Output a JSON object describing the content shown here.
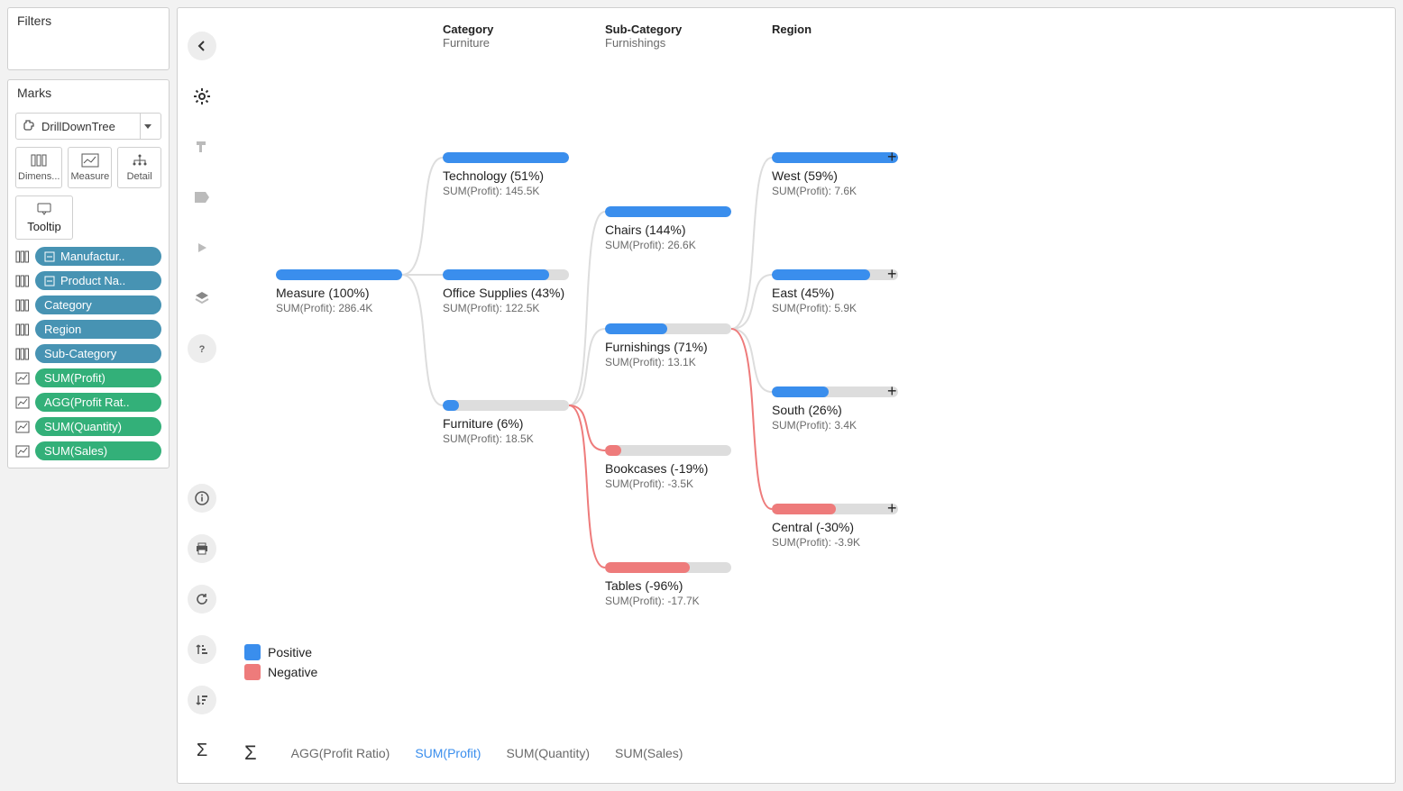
{
  "sidebar": {
    "filters_title": "Filters",
    "marks_title": "Marks",
    "mark_type": "DrillDownTree",
    "shelves": {
      "dimens": "Dimens...",
      "measure": "Measure",
      "detail": "Detail",
      "tooltip": "Tooltip"
    },
    "fields": [
      {
        "icon": "col",
        "pill": "blue",
        "prefix": "box",
        "label": "Manufactur.."
      },
      {
        "icon": "col",
        "pill": "blue",
        "prefix": "box",
        "label": "Product Na.."
      },
      {
        "icon": "col",
        "pill": "blue",
        "label": "Category"
      },
      {
        "icon": "col",
        "pill": "blue",
        "label": "Region"
      },
      {
        "icon": "col",
        "pill": "blue",
        "label": "Sub-Category"
      },
      {
        "icon": "line",
        "pill": "green",
        "label": "SUM(Profit)"
      },
      {
        "icon": "line",
        "pill": "green",
        "label": "AGG(Profit Rat.."
      },
      {
        "icon": "line",
        "pill": "green",
        "label": "SUM(Quantity)"
      },
      {
        "icon": "line",
        "pill": "green",
        "label": "SUM(Sales)"
      }
    ]
  },
  "headers": {
    "col1": {
      "title": "Category",
      "sub": "Furniture"
    },
    "col2": {
      "title": "Sub-Category",
      "sub": "Furnishings"
    },
    "col3": {
      "title": "Region",
      "sub": ""
    }
  },
  "legend": {
    "pos": "Positive",
    "neg": "Negative"
  },
  "footer": {
    "items": [
      "AGG(Profit Ratio)",
      "SUM(Profit)",
      "SUM(Quantity)",
      "SUM(Sales)"
    ],
    "active_index": 1
  },
  "nodes": {
    "root": {
      "label": "Measure (100%)",
      "sub": "SUM(Profit): 286.4K",
      "fill": 100,
      "type": "pos"
    },
    "tech": {
      "label": "Technology (51%)",
      "sub": "SUM(Profit): 145.5K",
      "fill": 100,
      "type": "pos"
    },
    "office": {
      "label": "Office Supplies (43%)",
      "sub": "SUM(Profit): 122.5K",
      "fill": 84,
      "type": "pos"
    },
    "furn": {
      "label": "Furniture (6%)",
      "sub": "SUM(Profit): 18.5K",
      "fill": 13,
      "type": "pos"
    },
    "chairs": {
      "label": "Chairs (144%)",
      "sub": "SUM(Profit): 26.6K",
      "fill": 100,
      "type": "pos"
    },
    "furnishings": {
      "label": "Furnishings (71%)",
      "sub": "SUM(Profit): 13.1K",
      "fill": 49,
      "type": "pos"
    },
    "bookcases": {
      "label": "Bookcases (-19%)",
      "sub": "SUM(Profit): -3.5K",
      "fill": 13,
      "type": "neg"
    },
    "tables": {
      "label": "Tables (-96%)",
      "sub": "SUM(Profit): -17.7K",
      "fill": 67,
      "type": "neg"
    },
    "west": {
      "label": "West (59%)",
      "sub": "SUM(Profit): 7.6K",
      "fill": 100,
      "type": "pos",
      "plus": true
    },
    "east": {
      "label": "East (45%)",
      "sub": "SUM(Profit): 5.9K",
      "fill": 78,
      "type": "pos",
      "plus": true
    },
    "south": {
      "label": "South (26%)",
      "sub": "SUM(Profit): 3.4K",
      "fill": 45,
      "type": "pos",
      "plus": true
    },
    "central": {
      "label": "Central (-30%)",
      "sub": "SUM(Profit): -3.9K",
      "fill": 51,
      "type": "neg",
      "plus": true
    }
  },
  "chart_data": {
    "type": "tree",
    "measure": "SUM(Profit)",
    "root": {
      "name": "Measure",
      "ratio_pct": 100,
      "profit_k": 286.4
    },
    "categories": [
      {
        "name": "Technology",
        "ratio_pct": 51,
        "profit_k": 145.5
      },
      {
        "name": "Office Supplies",
        "ratio_pct": 43,
        "profit_k": 122.5
      },
      {
        "name": "Furniture",
        "ratio_pct": 6,
        "profit_k": 18.5,
        "sub": [
          {
            "name": "Chairs",
            "ratio_pct": 144,
            "profit_k": 26.6
          },
          {
            "name": "Furnishings",
            "ratio_pct": 71,
            "profit_k": 13.1,
            "regions": [
              {
                "name": "West",
                "ratio_pct": 59,
                "profit_k": 7.6
              },
              {
                "name": "East",
                "ratio_pct": 45,
                "profit_k": 5.9
              },
              {
                "name": "South",
                "ratio_pct": 26,
                "profit_k": 3.4
              },
              {
                "name": "Central",
                "ratio_pct": -30,
                "profit_k": -3.9
              }
            ]
          },
          {
            "name": "Bookcases",
            "ratio_pct": -19,
            "profit_k": -3.5
          },
          {
            "name": "Tables",
            "ratio_pct": -96,
            "profit_k": -17.7
          }
        ]
      }
    ],
    "legend": [
      "Positive",
      "Negative"
    ]
  }
}
